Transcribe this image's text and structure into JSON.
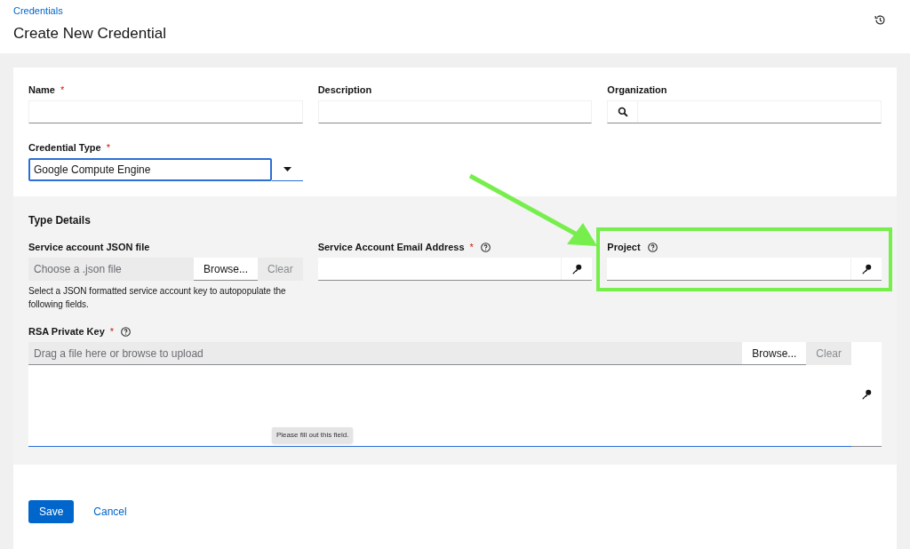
{
  "breadcrumb": "Credentials",
  "title": "Create New Credential",
  "fields": [
    {
      "kind": "text",
      "label": "Name",
      "required_mark": "*"
    },
    {
      "kind": "text",
      "label": "Description"
    },
    {
      "kind": "lookup",
      "label": "Organization"
    }
  ],
  "credential_type": {
    "label": "Credential Type",
    "required_mark": "*",
    "value": "Google Compute Engine"
  },
  "type_details": {
    "heading": "Type Details",
    "json_file": {
      "label": "Service account JSON file",
      "placeholder": "Choose a .json file",
      "browse": "Browse...",
      "clear": "Clear",
      "helper": "Select a JSON formatted service account key to autopopulate the following fields."
    },
    "secrets": [
      {
        "label": "Service Account Email Address",
        "required_mark": "*",
        "highlighted": false
      },
      {
        "label": "Project",
        "highlighted": true
      }
    ],
    "rsa_key": {
      "label": "RSA Private Key",
      "required_mark": "*",
      "placeholder": "Drag a file here or browse to upload",
      "browse": "Browse...",
      "clear": "Clear",
      "tooltip": "Please fill out this field."
    }
  },
  "buttons": {
    "save": "Save",
    "cancel": "Cancel"
  }
}
